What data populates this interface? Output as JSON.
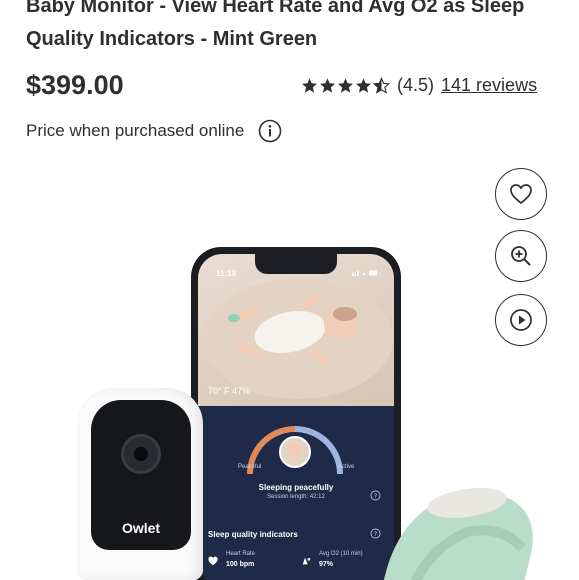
{
  "product": {
    "title": "Baby Monitor - View Heart Rate and Avg O2 as Sleep Quality Indicators - Mint Green",
    "price": "$399.00",
    "rating_value": "(4.5)",
    "rating_stars": 4.5,
    "reviews_label": "141 reviews",
    "price_note": "Price when purchased online"
  },
  "actions": [
    {
      "icon": "heart-icon"
    },
    {
      "icon": "zoom-in-icon"
    },
    {
      "icon": "play-icon"
    }
  ],
  "image": {
    "phone": {
      "time": "11:19",
      "temp_battery": "70° F  47%",
      "left_label": "Peaceful",
      "right_label": "Active",
      "status": "Sleeping peacefully",
      "session": "Session length: 42:12",
      "section_title": "Sleep quality indicators",
      "heart_rate_label": "Heart Rate",
      "heart_rate_value": "100 bpm",
      "o2_label": "Avg O2 (10 min)",
      "o2_value": "97%"
    },
    "camera_brand": "Owlet"
  },
  "colors": {
    "text": "#2e2f32",
    "phone_dash": "#1e2a47",
    "sock": "#b9dccb"
  }
}
